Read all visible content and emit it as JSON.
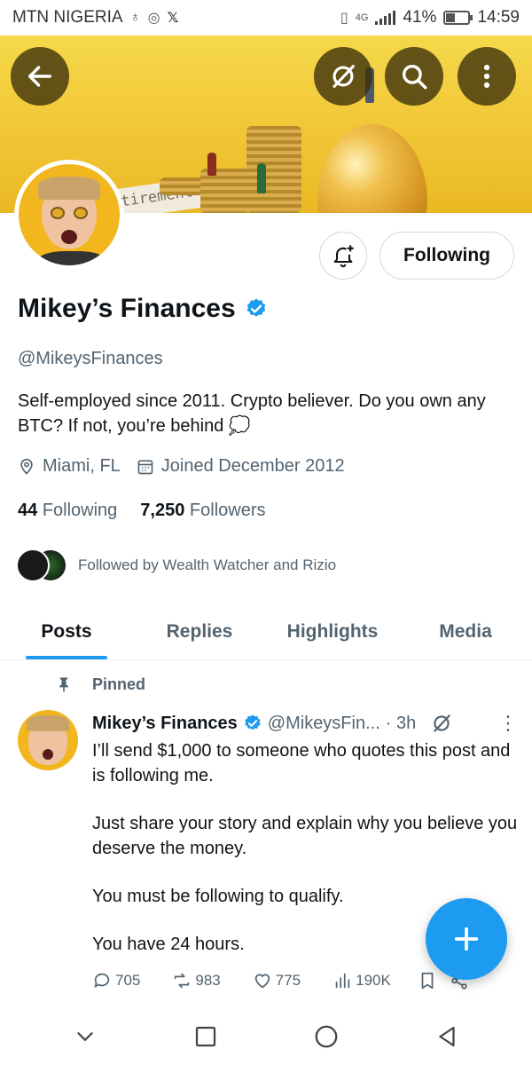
{
  "status_bar": {
    "carrier": "MTN NIGERIA",
    "network": "4G",
    "battery_pct": "41%",
    "battery_level": 0.41,
    "time": "14:59"
  },
  "header": {
    "back_icon": "arrow-left-icon",
    "grok_icon": "grok-icon",
    "search_icon": "search-icon",
    "more_icon": "more-vertical-icon",
    "banner_sign": "Retirement"
  },
  "profile": {
    "name": "Mikey’s Finances",
    "handle": "@MikeysFinances",
    "bio": "Self-employed since 2011. Crypto believer. Do you own any BTC? If not, you’re behind 💭",
    "location": "Miami, FL",
    "joined": "Joined December 2012",
    "following_count": "44",
    "following_label": "Following",
    "followers_count": "7,250",
    "followers_label": "Followers",
    "followed_by": "Followed by Wealth Watcher and Rizio",
    "follow_button": "Following",
    "verified_color": "#1d9bf0"
  },
  "tabs": [
    {
      "label": "Posts",
      "active": true
    },
    {
      "label": "Replies",
      "active": false
    },
    {
      "label": "Highlights",
      "active": false
    },
    {
      "label": "Media",
      "active": false
    }
  ],
  "post": {
    "pinned_label": "Pinned",
    "author_name": "Mikey’s Finances",
    "author_handle": "@MikeysFin...",
    "time": "· 3h",
    "paragraphs": [
      "I’ll send $1,000 to someone who quotes this post and is following me.",
      "Just share your story and explain why you believe you deserve the money.",
      "You must be following to qualify.",
      "You have 24 hours."
    ],
    "replies": "705",
    "reposts": "983",
    "likes": "775",
    "views": "190K"
  },
  "fab": {
    "icon": "plus-icon",
    "color": "#1d9bf0"
  },
  "nav": {
    "icons": [
      "chevron-down-icon",
      "square-icon",
      "circle-icon",
      "triangle-back-icon"
    ]
  }
}
